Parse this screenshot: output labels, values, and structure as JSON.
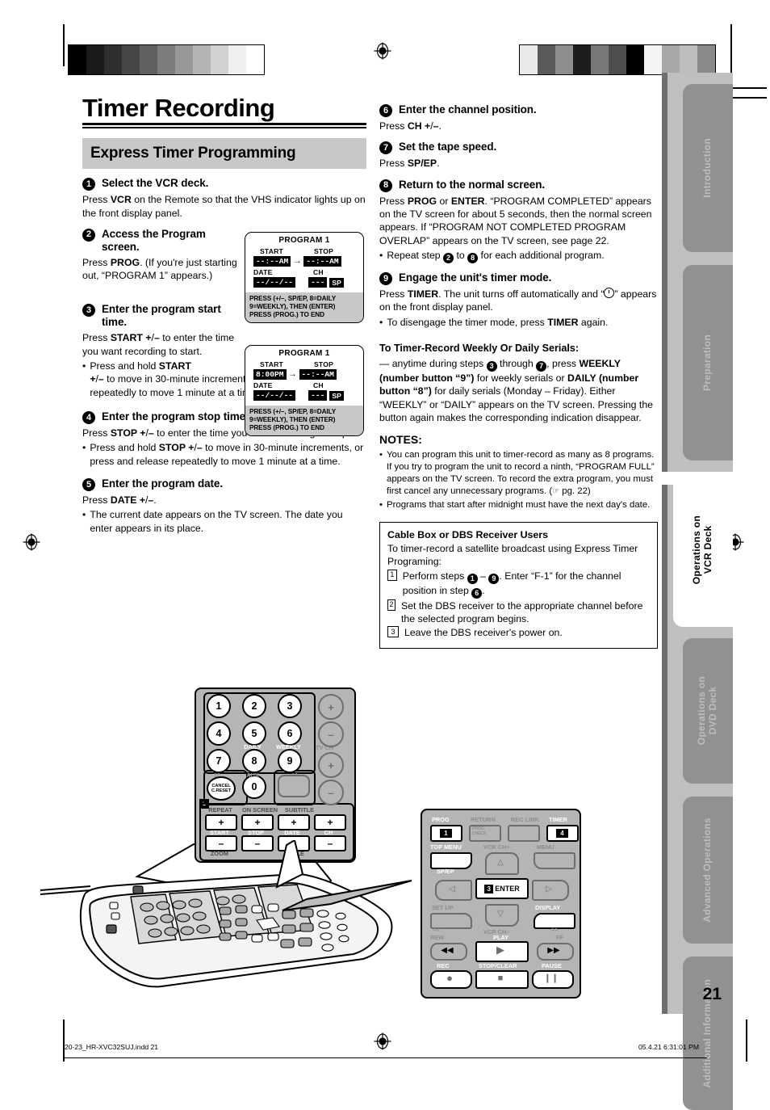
{
  "page": {
    "title": "Timer Recording",
    "section_heading": "Express Timer Programming",
    "page_number": "21"
  },
  "side_tabs": [
    {
      "label": "Introduction",
      "active": false
    },
    {
      "label": "Preparation",
      "active": false
    },
    {
      "label": "Operations on\nVCR Deck",
      "active": true
    },
    {
      "label": "Operations on\nDVD Deck",
      "active": false
    },
    {
      "label": "Advanced Operations",
      "active": false
    },
    {
      "label": "Additional Information",
      "active": false
    }
  ],
  "steps": [
    {
      "num": "1",
      "heading": "Select the VCR deck.",
      "body": "Press VCR on the Remote so that the VHS indicator lights up on the front display panel."
    },
    {
      "num": "2",
      "heading": "Access the Program screen.",
      "body": "Press PROG. (If you're just starting out, “PROGRAM 1” appears.)"
    },
    {
      "num": "3",
      "heading": "Enter the program start time.",
      "body": "Press START +/– to enter the time you want recording to start.",
      "bullet": "Press and hold START +/– to move in 30-minute increments, or press and release repeatedly to move 1 minute at a time."
    },
    {
      "num": "4",
      "heading": "Enter the program stop time.",
      "body": "Press STOP +/– to enter the time you want recording to stop.",
      "bullet": "Press and hold STOP +/– to move in 30-minute increments, or press and release repeatedly to move 1 minute at a time."
    },
    {
      "num": "5",
      "heading": "Enter the program date.",
      "body": "Press DATE +/–.",
      "bullet": "The current date appears on the TV screen. The date you enter appears in its place."
    },
    {
      "num": "6",
      "heading": "Enter the channel position.",
      "body": "Press CH +/–."
    },
    {
      "num": "7",
      "heading": "Set the tape speed.",
      "body": "Press SP/EP."
    },
    {
      "num": "8",
      "heading": "Return to the normal screen.",
      "body": "Press PROG or ENTER. “PROGRAM COMPLETED” appears on the TV screen for about 5 seconds, then the normal screen appears. If “PROGRAM NOT COMPLETED PROGRAM OVERLAP” appears on the TV screen, see page 22.",
      "bullet": "Repeat step 2 to 8 for each additional program."
    },
    {
      "num": "9",
      "heading": "Engage the unit's timer mode.",
      "body": "Press TIMER. The unit turns off automatically and “⌚” appears on the front display panel.",
      "bullet": "To disengage the timer mode, press TIMER again."
    }
  ],
  "serials": {
    "heading": "To Timer-Record Weekly Or Daily Serials:",
    "body": "— anytime during steps 3 through 7, press WEEKLY (number button “9”) for weekly serials or DAILY (number button “8”) for daily serials (Monday – Friday). Either “WEEKLY” or “DAILY” appears on the TV screen. Pressing the button again makes the corresponding indication disappear."
  },
  "notes": {
    "heading": "NOTES:",
    "items": [
      "You can program this unit to timer-record as many as 8 programs. If you try to program the unit to record a ninth, “PROGRAM FULL” appears on the TV screen. To record the extra program, you must first cancel any unnecessary programs. (☞ pg. 22)",
      "Programs that start after midnight must have the next day's date."
    ]
  },
  "cable_box": {
    "heading": "Cable Box or DBS Receiver Users",
    "intro": "To timer-record a satellite broadcast using Express Timer Programing:",
    "steps": [
      {
        "num": "1",
        "text": "Perform steps 1 – 9. Enter “F-1” for the channel position in step 6."
      },
      {
        "num": "2",
        "text": "Set the DBS receiver to the appropriate channel before the selected program begins."
      },
      {
        "num": "3",
        "text": "Leave the DBS receiver's power on."
      }
    ]
  },
  "osd_screens": [
    {
      "title": "PROGRAM 1",
      "labels": {
        "start": "START",
        "stop": "STOP",
        "date": "DATE",
        "ch": "CH"
      },
      "start_value": "--:--AM",
      "stop_value": "--:--AM",
      "date_value": "--/--/--",
      "ch_value": "---",
      "speed": "SP",
      "arrow": "→",
      "footer": "PRESS (+/–, SP/EP, 8=DAILY 9=WEEKLY), THEN (ENTER)\nPRESS (PROG.) TO END"
    },
    {
      "title": "PROGRAM 1",
      "labels": {
        "start": "START",
        "stop": "STOP",
        "date": "DATE",
        "ch": "CH"
      },
      "start_value": "8:00PM",
      "stop_value": "--:--AM",
      "date_value": "--/--/--",
      "ch_value": "---",
      "speed": "SP",
      "arrow": "→",
      "footer": "PRESS (+/–, SP/EP, 8=DAILY 9=WEEKLY), THEN (ENTER)\nPRESS (PROG.) TO END"
    }
  ],
  "keypad": {
    "numbers": [
      "1",
      "2",
      "3",
      "4",
      "5",
      "6",
      "7",
      "8",
      "9",
      "0"
    ],
    "labels": {
      "daily": "DAILY",
      "weekly": "WEEKLY",
      "ten": "10",
      "aux": "AUX",
      "plus_ten": "+10",
      "cancel": "CANCEL",
      "creset": "C.RESET",
      "tv_ch": "TV CH",
      "repeat": "REPEAT",
      "on_screen": "ON SCREEN",
      "subtitle": "SUBTITLE",
      "start": "START",
      "stop": "STOP",
      "date": "DATE",
      "ch": "CH",
      "zoom": "ZOOM",
      "angle": "ANGLE",
      "plus": "+",
      "minus": "–",
      "step_badge": "2"
    }
  },
  "remote2": {
    "labels": {
      "prog": "PROG",
      "return": "RETURN",
      "prog_check": "PROG.\nCHECK",
      "rec_link": "REC LINK",
      "timer": "TIMER",
      "top_menu": "TOP MENU",
      "sp_ep": "SP/EP",
      "vcr_ch_plus": "VCR CH+",
      "vcr_ch_minus": "VCR CH–",
      "menu": "MENU",
      "enter": "ENTER",
      "set_up": "SET UP",
      "display": "DISPLAY",
      "rew": "REW",
      "ff": "FF",
      "play": "PLAY",
      "rec": "REC",
      "stop_clear": "STOP/CLEAR",
      "pause": "PAUSE",
      "rew_arrows": "<<",
      "ff_arrows": ">>"
    },
    "badges": {
      "prog": "1",
      "timer": "4",
      "enter": "3"
    }
  },
  "footer": {
    "left": "20-23_HR-XVC32SUJ.indd   21",
    "right": "05.4.21   6:31:01 PM"
  },
  "colors": {
    "band": "#c8c8c8",
    "rail": "#bfbfbf",
    "tab": "#919191",
    "spine": "#6e6e6e",
    "remote_body": "#b5b5b5"
  }
}
